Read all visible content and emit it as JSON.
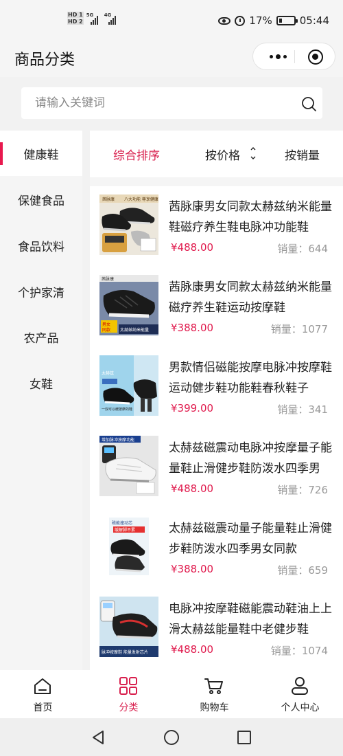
{
  "status_bar": {
    "hd1": "HD 1",
    "hd2": "HD 2",
    "signal1_label": "5G",
    "signal2_label": "4G",
    "battery": "17%",
    "time": "05:44"
  },
  "header": {
    "title": "商品分类"
  },
  "search": {
    "placeholder": "请输入关键词"
  },
  "sidebar": {
    "items": [
      {
        "label": "健康鞋",
        "active": true
      },
      {
        "label": "保健食品",
        "active": false
      },
      {
        "label": "食品饮料",
        "active": false
      },
      {
        "label": "个护家清",
        "active": false
      },
      {
        "label": "农产品",
        "active": false
      },
      {
        "label": "女鞋",
        "active": false
      }
    ]
  },
  "sort": {
    "items": [
      {
        "label": "综合排序",
        "active": true
      },
      {
        "label": "按价格",
        "active": false
      },
      {
        "label": "按销量",
        "active": false
      }
    ]
  },
  "products": [
    {
      "name": "茜脉康男女同款太赫兹纳米能量鞋磁疗养生鞋电脉冲功能鞋",
      "price": "¥488.00",
      "sales_label": "销量：",
      "sales": "644",
      "image_caption": "茜脉康 八大功能 尊享健康"
    },
    {
      "name": "茜脉康男女同款太赫兹纳米能量磁疗养生鞋运动按摩鞋",
      "price": "¥388.00",
      "sales_label": "销量：",
      "sales": "1077",
      "image_caption": "男女同款 太赫兹纳米能量"
    },
    {
      "name": "男款情侣磁能按摩电脉冲按摩鞋运动健步鞋功能鞋春秋鞋子",
      "price": "¥399.00",
      "sales_label": "销量：",
      "sales": "341",
      "image_caption": "一双可以缓按摩的鞋"
    },
    {
      "name": "太赫兹磁震动电脉冲按摩量子能量鞋止滑健步鞋防泼水四季男",
      "price": "¥488.00",
      "sales_label": "销量：",
      "sales": "726",
      "image_caption": "增加脉冲按摩功能"
    },
    {
      "name": "太赫兹磁震动量子能量鞋止滑健步鞋防泼水四季男女同款",
      "price": "¥388.00",
      "sales_label": "销量：",
      "sales": "659",
      "image_caption": "磁能撞动芯 缓解脚不累"
    },
    {
      "name": "电脉冲按摩鞋磁能震动鞋油上上滑太赫兹能量鞋中老健步鞋",
      "price": "¥488.00",
      "sales_label": "销量：",
      "sales": "1074",
      "image_caption": "脉冲按摩鞋 能量发射芯片"
    }
  ],
  "tab_bar": {
    "items": [
      {
        "label": "首页",
        "icon": "home-icon",
        "active": false
      },
      {
        "label": "分类",
        "icon": "category-icon",
        "active": true
      },
      {
        "label": "购物车",
        "icon": "cart-icon",
        "active": false
      },
      {
        "label": "个人中心",
        "icon": "profile-icon",
        "active": false
      }
    ]
  },
  "colors": {
    "accent": "#d81e4c",
    "muted": "#999999"
  }
}
